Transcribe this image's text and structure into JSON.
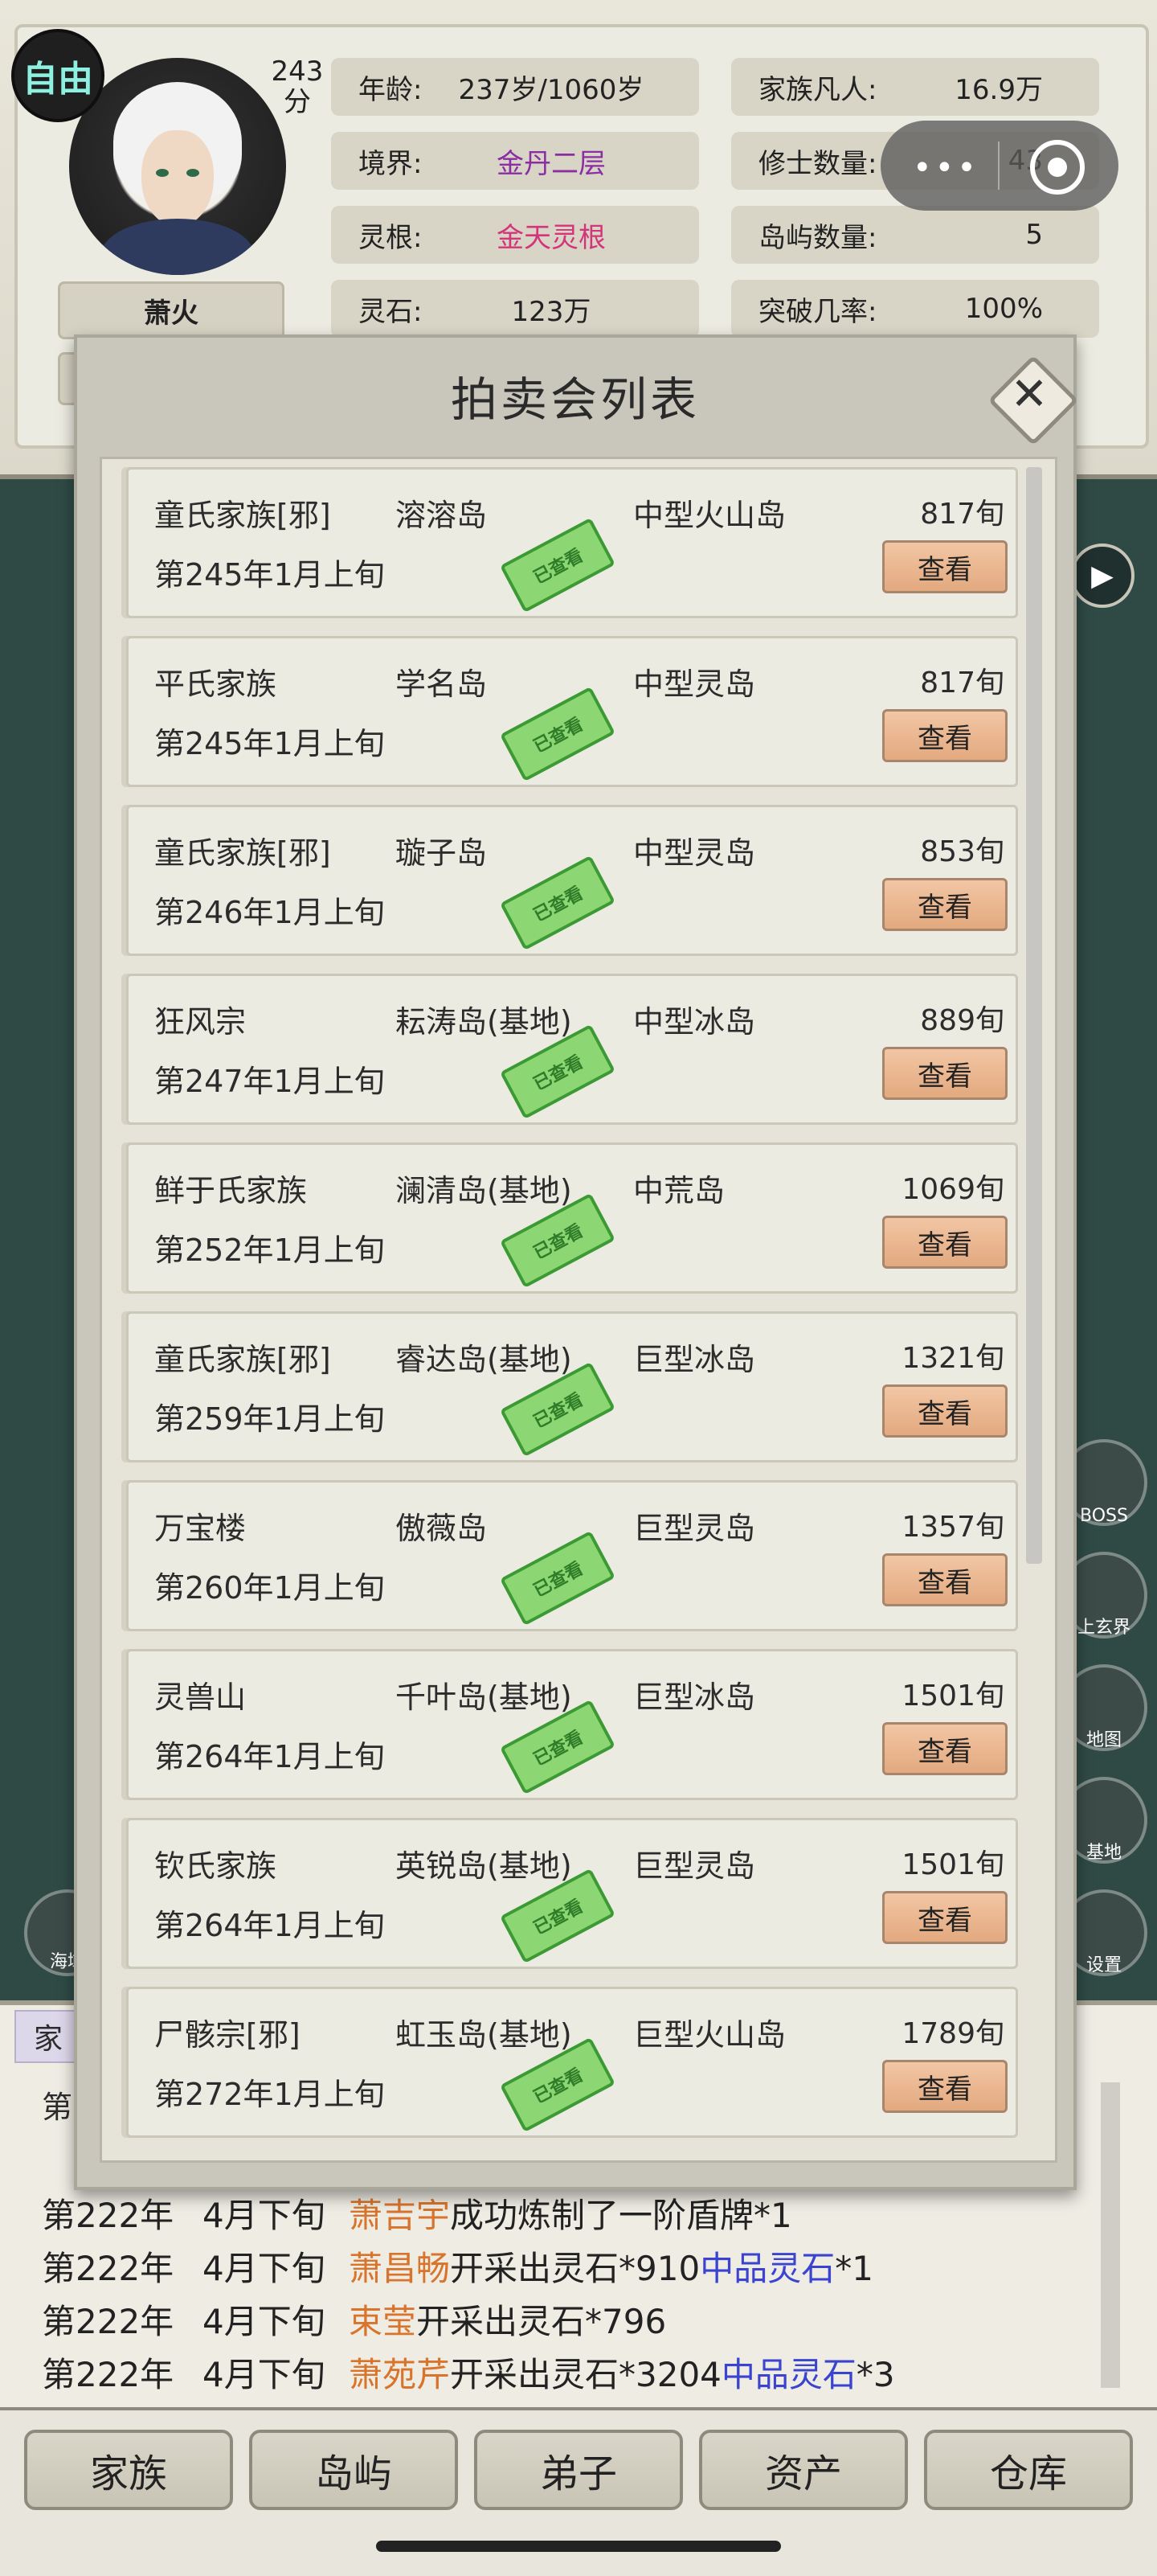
{
  "header": {
    "free_badge": "自由",
    "score_num": "243",
    "score_unit": "分",
    "name": "萧火",
    "stats": [
      {
        "label": "年龄:",
        "value": "237岁/1060岁"
      },
      {
        "label": "境界:",
        "value": "金丹二层"
      },
      {
        "label": "灵根:",
        "value": "金天灵根"
      },
      {
        "label": "灵石:",
        "value": "123万"
      },
      {
        "label": "家族凡人:",
        "value": "16.9万"
      },
      {
        "label": "修士数量:",
        "value": "43"
      },
      {
        "label": "岛屿数量:",
        "value": "5"
      },
      {
        "label": "突破几率:",
        "value": "100%"
      }
    ]
  },
  "modal": {
    "title": "拍卖会列表",
    "close_icon": "close-icon",
    "view_label": "查看",
    "stamp_label": "已查看",
    "rows": [
      {
        "clan": "童氏家族[邪]",
        "island": "溶溶岛",
        "type": "中型火山岛",
        "duration": "817旬",
        "date": "第245年1月上旬"
      },
      {
        "clan": "平氏家族",
        "island": "学名岛",
        "type": "中型灵岛",
        "duration": "817旬",
        "date": "第245年1月上旬"
      },
      {
        "clan": "童氏家族[邪]",
        "island": "璇子岛",
        "type": "中型灵岛",
        "duration": "853旬",
        "date": "第246年1月上旬"
      },
      {
        "clan": "狂风宗",
        "island": "耘涛岛(基地)",
        "type": "中型冰岛",
        "duration": "889旬",
        "date": "第247年1月上旬"
      },
      {
        "clan": "鲜于氏家族",
        "island": "澜清岛(基地)",
        "type": "中荒岛",
        "duration": "1069旬",
        "date": "第252年1月上旬"
      },
      {
        "clan": "童氏家族[邪]",
        "island": "睿达岛(基地)",
        "type": "巨型冰岛",
        "duration": "1321旬",
        "date": "第259年1月上旬"
      },
      {
        "clan": "万宝楼",
        "island": "傲薇岛",
        "type": "巨型灵岛",
        "duration": "1357旬",
        "date": "第260年1月上旬"
      },
      {
        "clan": "灵兽山",
        "island": "千叶岛(基地)",
        "type": "巨型冰岛",
        "duration": "1501旬",
        "date": "第264年1月上旬"
      },
      {
        "clan": "钦氏家族",
        "island": "英锐岛(基地)",
        "type": "巨型灵岛",
        "duration": "1501旬",
        "date": "第264年1月上旬"
      },
      {
        "clan": "尸骸宗[邪]",
        "island": "虹玉岛(基地)",
        "type": "巨型火山岛",
        "duration": "1789旬",
        "date": "第272年1月上旬"
      }
    ]
  },
  "log": {
    "tab": "家",
    "first": "第",
    "lines": [
      {
        "year": "第222年",
        "time": "4月下旬",
        "name": "萧吉宇",
        "text": "成功炼制了一阶盾牌*1",
        "extra": "",
        "extra_count": ""
      },
      {
        "year": "第222年",
        "time": "4月下旬",
        "name": "萧昌畅",
        "text": "开采出灵石*910",
        "extra": "中品灵石",
        "extra_count": "*1"
      },
      {
        "year": "第222年",
        "time": "4月下旬",
        "name": "束莹",
        "text": "开采出灵石*796",
        "extra": "",
        "extra_count": ""
      },
      {
        "year": "第222年",
        "time": "4月下旬",
        "name": "萧苑芹",
        "text": "开采出灵石*3204",
        "extra": "中品灵石",
        "extra_count": "*3"
      }
    ]
  },
  "side": {
    "boss": "BOSS",
    "realm": "上玄界",
    "map": "地图",
    "base": "基地",
    "settings": "设置",
    "sea": "海域"
  },
  "nav": [
    "家族",
    "岛屿",
    "弟子",
    "资产",
    "仓库"
  ]
}
